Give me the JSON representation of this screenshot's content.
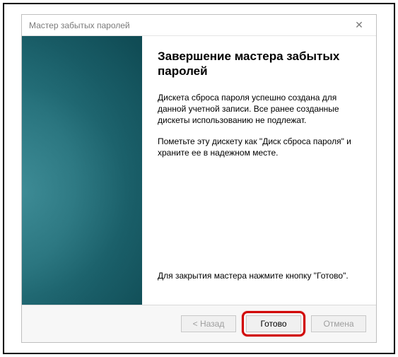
{
  "titlebar": {
    "title": "Мастер забытых паролей",
    "close_glyph": "✕"
  },
  "main": {
    "heading": "Завершение мастера забытых паролей",
    "para1": "Дискета сброса пароля успешно создана для данной учетной записи. Все ранее созданные дискеты использованию не подлежат.",
    "para2": "Пометьте эту дискету как \"Диск сброса пароля\" и храните ее в надежном месте.",
    "closing": "Для закрытия мастера нажмите кнопку \"Готово\"."
  },
  "buttons": {
    "back": "< Назад",
    "finish": "Готово",
    "cancel": "Отмена"
  }
}
